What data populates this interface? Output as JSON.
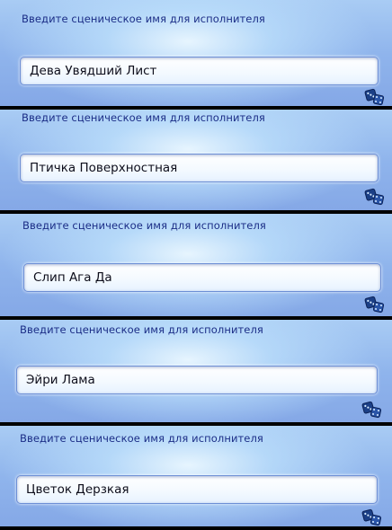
{
  "panels": [
    {
      "prompt": "Введите сценическое имя для исполнителя",
      "value": "Дева Увядший Лист",
      "icon": "dice-icon"
    },
    {
      "prompt": "Введите сценическое имя для исполнителя",
      "value": "Птичка Поверхностная",
      "icon": "dice-icon"
    },
    {
      "prompt": "Введите сценическое имя для исполнителя",
      "value": "Слип Ага Да",
      "icon": "dice-icon"
    },
    {
      "prompt": "Введите сценическое имя для исполнителя",
      "value": "Эйри Лама",
      "icon": "dice-icon"
    },
    {
      "prompt": "Введите сценическое имя для исполнителя",
      "value": "Цветок Дерзкая",
      "icon": "dice-icon"
    }
  ],
  "colors": {
    "prompt_text": "#1b2d86",
    "panel_blue": "#8fb4ec",
    "separator": "#000000"
  }
}
